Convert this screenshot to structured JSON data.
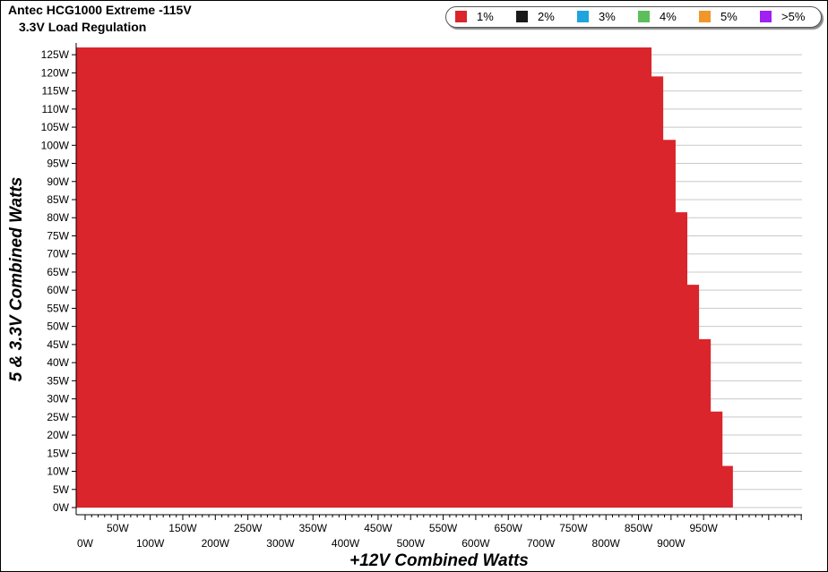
{
  "chart_data": {
    "type": "area",
    "title": "Antec HCG1000 Extreme -115V",
    "subtitle": "3.3V Load Regulation",
    "xlabel": "+12V Combined Watts",
    "ylabel": "5 & 3.3V Combined Watts",
    "xlim": [
      0,
      990
    ],
    "ylim": [
      0,
      128
    ],
    "x_ticks": [
      "0W",
      "50W",
      "100W",
      "150W",
      "200W",
      "250W",
      "300W",
      "350W",
      "400W",
      "450W",
      "500W",
      "550W",
      "600W",
      "650W",
      "700W",
      "750W",
      "800W",
      "850W",
      "900W",
      "950W"
    ],
    "y_ticks": [
      "0W",
      "5W",
      "10W",
      "15W",
      "20W",
      "25W",
      "30W",
      "35W",
      "40W",
      "45W",
      "50W",
      "55W",
      "60W",
      "65W",
      "70W",
      "75W",
      "80W",
      "85W",
      "90W",
      "95W",
      "100W",
      "105W",
      "110W",
      "115W",
      "120W",
      "125W"
    ],
    "grid": "horizontal",
    "legend_position": "top-right",
    "legend": [
      {
        "label": "1%",
        "color": "#d9252b"
      },
      {
        "label": "2%",
        "color": "#1a1a1a"
      },
      {
        "label": "3%",
        "color": "#1ea5dc"
      },
      {
        "label": "4%",
        "color": "#5cbf5c"
      },
      {
        "label": "5%",
        "color": "#f0962a"
      },
      {
        "label": ">5%",
        "color": "#a020f0"
      }
    ],
    "series": [
      {
        "name": "1%",
        "color": "#d9252b",
        "steps": [
          {
            "x": 870,
            "y": 127
          },
          {
            "x": 888,
            "y": 119
          },
          {
            "x": 907,
            "y": 101.5
          },
          {
            "x": 925,
            "y": 81.5
          },
          {
            "x": 943,
            "y": 61.5
          },
          {
            "x": 961,
            "y": 46.5
          },
          {
            "x": 979,
            "y": 26.5
          },
          {
            "x": 995,
            "y": 11.5
          }
        ]
      }
    ]
  }
}
